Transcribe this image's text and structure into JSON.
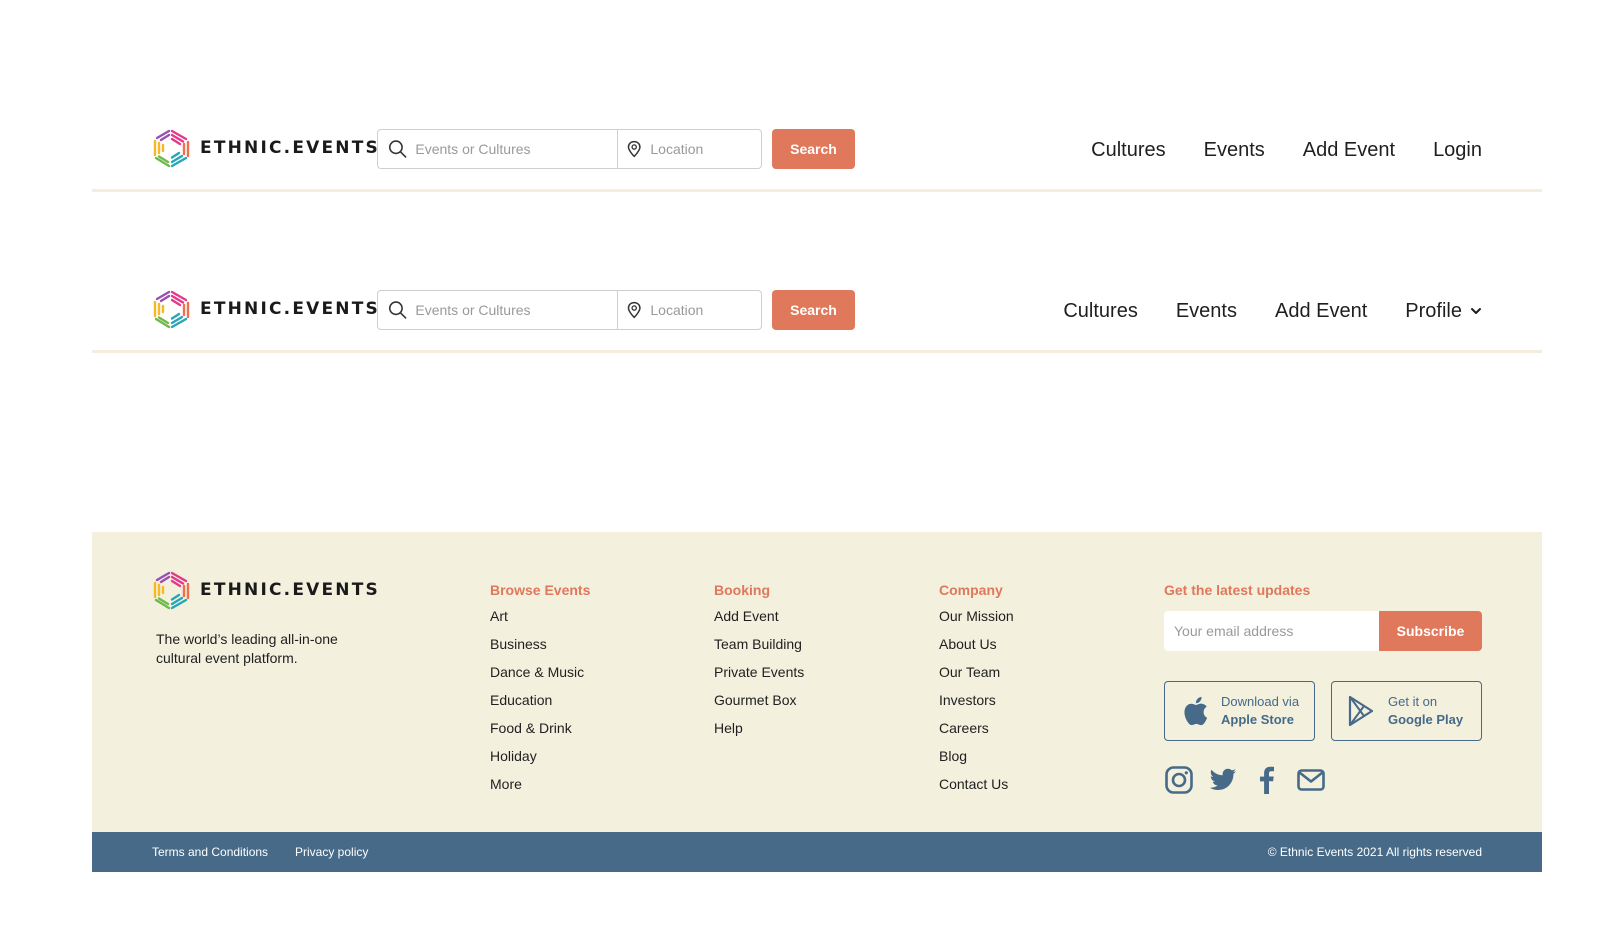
{
  "brand": {
    "name": "ETHNIC.EVENTS"
  },
  "search": {
    "events_placeholder": "Events or Cultures",
    "location_placeholder": "Location",
    "button_label": "Search"
  },
  "header_guest": {
    "nav": [
      {
        "label": "Cultures"
      },
      {
        "label": "Events"
      },
      {
        "label": "Add Event"
      },
      {
        "label": "Login"
      }
    ]
  },
  "header_user": {
    "nav": [
      {
        "label": "Cultures"
      },
      {
        "label": "Events"
      },
      {
        "label": "Add Event"
      },
      {
        "label": "Profile"
      }
    ]
  },
  "footer": {
    "tagline": "The world’s leading all-in-one cultural event platform.",
    "browse": {
      "title": "Browse Events",
      "items": [
        "Art",
        "Business",
        "Dance & Music",
        "Education",
        "Food & Drink",
        "Holiday",
        "More"
      ]
    },
    "booking": {
      "title": "Booking",
      "items": [
        "Add Event",
        "Team Building",
        "Private Events",
        "Gourmet Box",
        "Help"
      ]
    },
    "company": {
      "title": "Company",
      "items": [
        "Our Mission",
        "About Us",
        "Our Team",
        "Investors",
        "Careers",
        "Blog",
        "Contact Us"
      ]
    },
    "updates": {
      "title": "Get the latest updates",
      "email_placeholder": "Your email address",
      "subscribe_label": "Subscribe"
    },
    "stores": {
      "apple_line1": "Download via",
      "apple_line2": "Apple Store",
      "google_line1": "Get it on",
      "google_line2": "Google Play"
    },
    "social_icons": [
      "instagram-icon",
      "twitter-icon",
      "facebook-icon",
      "mail-icon"
    ]
  },
  "bottom_bar": {
    "terms": "Terms and Conditions",
    "privacy": "Privacy policy",
    "copyright": "© Ethnic Events 2021 All rights reserved"
  },
  "colors": {
    "accent": "#e0785b",
    "footer_bg": "#f3f0de",
    "bottom_bar_bg": "#466a88",
    "divider": "#f3eedd"
  }
}
